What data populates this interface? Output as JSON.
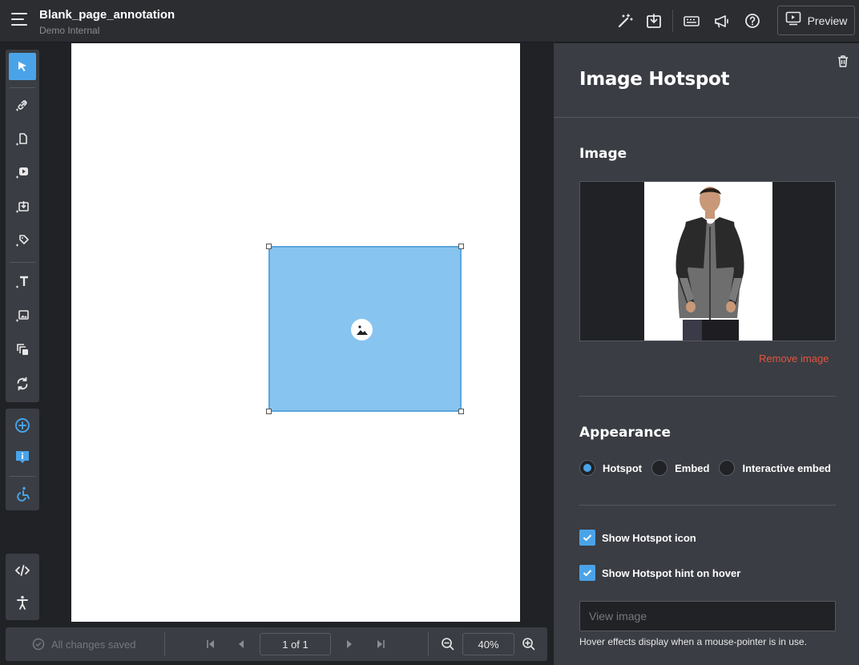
{
  "header": {
    "title": "Blank_page_annotation",
    "subtitle": "Demo Internal",
    "preview_label": "Preview",
    "icons": [
      "magic-wand-icon",
      "download-icon",
      "keyboard-icon",
      "megaphone-icon",
      "help-icon",
      "preview-icon"
    ]
  },
  "toolbar": {
    "tools": [
      "select",
      "link",
      "page",
      "video",
      "download",
      "tag",
      "text",
      "image",
      "copy",
      "refresh",
      "add",
      "info",
      "accessibility-switch"
    ],
    "bottom_tools": [
      "code",
      "accessibility"
    ]
  },
  "canvas": {
    "hotspot_fill": "#87c4f0"
  },
  "bottombar": {
    "status": "All changes saved",
    "page_indicator": "1 of 1",
    "zoom": "40%"
  },
  "panel": {
    "title": "Image Hotspot",
    "image_section": "Image",
    "remove_label": "Remove image",
    "appearance_section": "Appearance",
    "appearance_options": [
      {
        "label": "Hotspot",
        "selected": true
      },
      {
        "label": "Embed",
        "selected": false
      },
      {
        "label": "Interactive embed",
        "selected": false
      }
    ],
    "show_icon_label": "Show Hotspot icon",
    "show_icon_checked": true,
    "show_hint_label": "Show Hotspot hint on hover",
    "show_hint_checked": true,
    "hint_placeholder": "View image",
    "hint_value": "",
    "help_text": "Hover effects display when a mouse-pointer is in use."
  },
  "colors": {
    "accent": "#4aa3e8",
    "danger": "#e5533d",
    "panel_bg": "#3a3d43",
    "app_bg": "#202225"
  }
}
